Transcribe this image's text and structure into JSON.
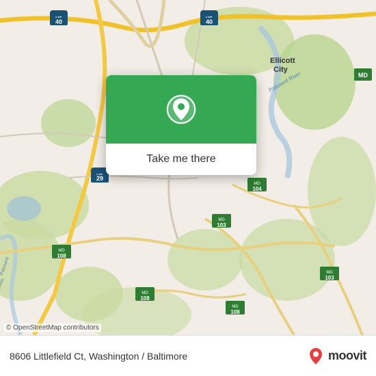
{
  "map": {
    "attribution": "© OpenStreetMap contributors",
    "card": {
      "button_label": "Take me there",
      "pin_icon": "location-pin"
    }
  },
  "footer": {
    "address": "8606 Littlefield Ct, Washington / Baltimore",
    "logo_text": "moovit"
  }
}
